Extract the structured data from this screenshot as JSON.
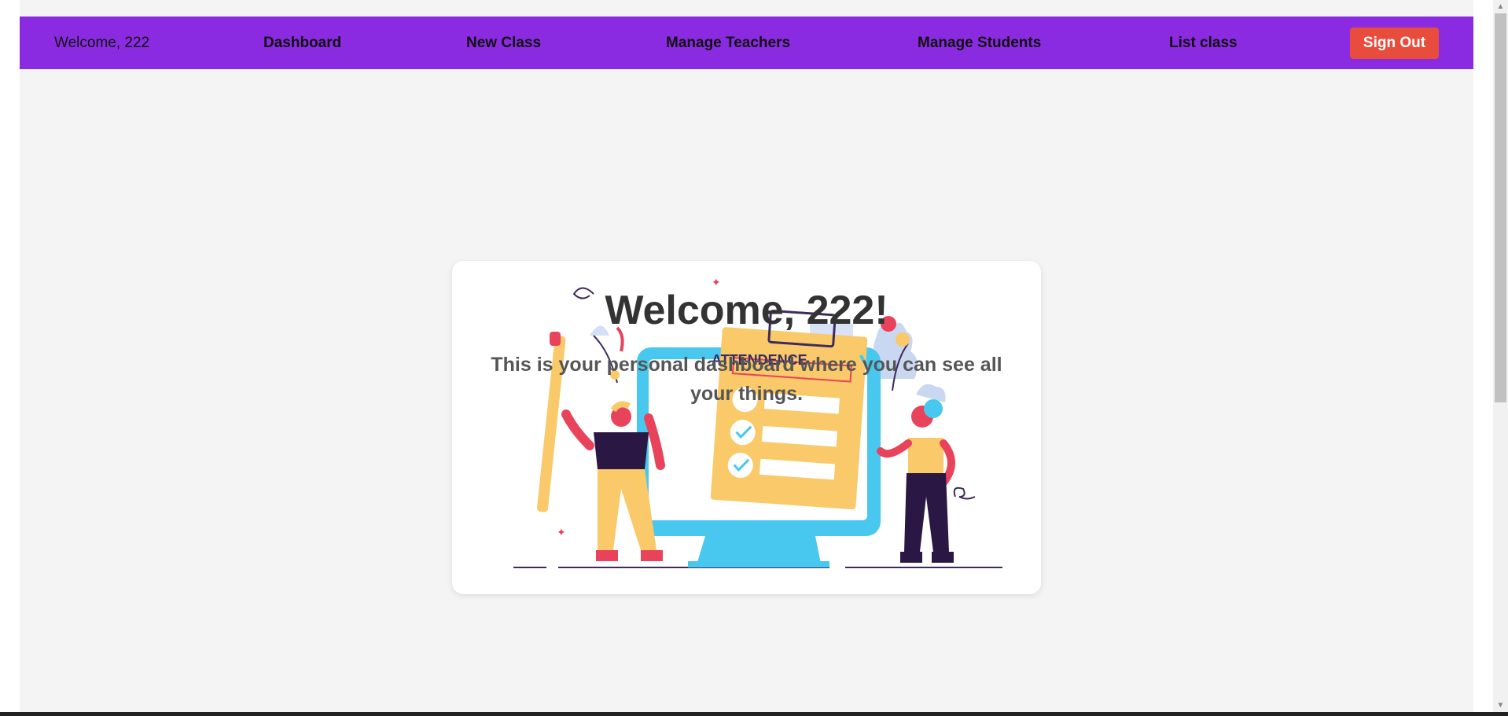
{
  "navbar": {
    "welcome": "Welcome, 222",
    "links": [
      "Dashboard",
      "New Class",
      "Manage Teachers",
      "Manage Students",
      "List class"
    ],
    "signout": "Sign Out",
    "color": "#8a2be2",
    "signout_color": "#e74c3c"
  },
  "card": {
    "title": "Welcome, 222!",
    "subtitle": "This is your personal dashboard where you can see all your things.",
    "illustration": {
      "icon": "attendance-illustration",
      "board_label": "ATTENDENCE"
    }
  },
  "scrollbar": {
    "up_icon": "scroll-up-arrow-icon",
    "down_icon": "scroll-down-arrow-icon"
  }
}
